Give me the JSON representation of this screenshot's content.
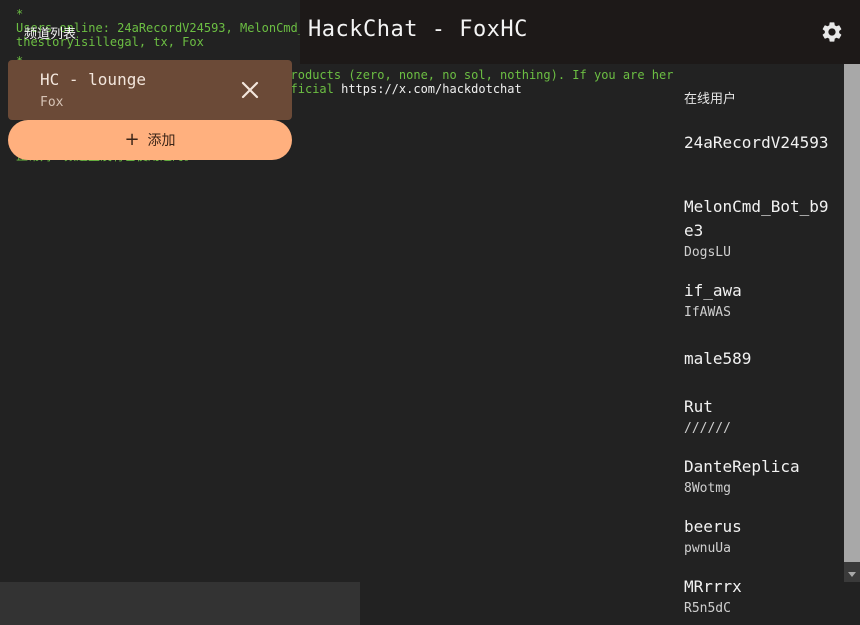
{
  "log": {
    "lines": [
      {
        "text": "*"
      },
      {
        "text": "Users online: 24aRecordV24593, MelonCmd_"
      },
      {
        "text": "thestoryisillegal, tx, Fox"
      },
      {
        "text": "*"
      },
      {
        "text": "                                 pto products (zero, none, no sol, nothing). If you are here because of a"
      },
      {
        "text": "                                 he official ",
        "link": "https://x.com/hackdotchat"
      },
      {
        "text": "*"
      },
      {
        "text": "正常对一频道里没有已使用过的。"
      }
    ]
  },
  "header": {
    "title": "HackChat - FoxHC",
    "settings_icon": "gear-icon"
  },
  "drawer": {
    "heading": "频道列表",
    "channel": {
      "name": "HC - lounge",
      "nick": "Fox"
    },
    "close_icon": "close-icon",
    "add_label": "添加",
    "add_icon": "+"
  },
  "users": {
    "heading": "在线用户",
    "list": [
      {
        "name": "24aRecordV24593",
        "trip": ""
      },
      {
        "name": "MelonCmd_Bot_b9e3",
        "trip": "DogsLU"
      },
      {
        "name": "if_awa",
        "trip": "IfAWAS"
      },
      {
        "name": "male589",
        "trip": ""
      },
      {
        "name": "Rut",
        "trip": "//////"
      },
      {
        "name": "DanteReplica",
        "trip": "8Wotmg"
      },
      {
        "name": "beerus",
        "trip": "pwnuUa"
      },
      {
        "name": "MRrrrx",
        "trip": "R5n5dC"
      }
    ]
  },
  "colors": {
    "background": "#222222",
    "header": "#1d1918",
    "channel_card": "#6b4a37",
    "add_button": "#ffb07e",
    "log_text": "#6cbf43"
  }
}
